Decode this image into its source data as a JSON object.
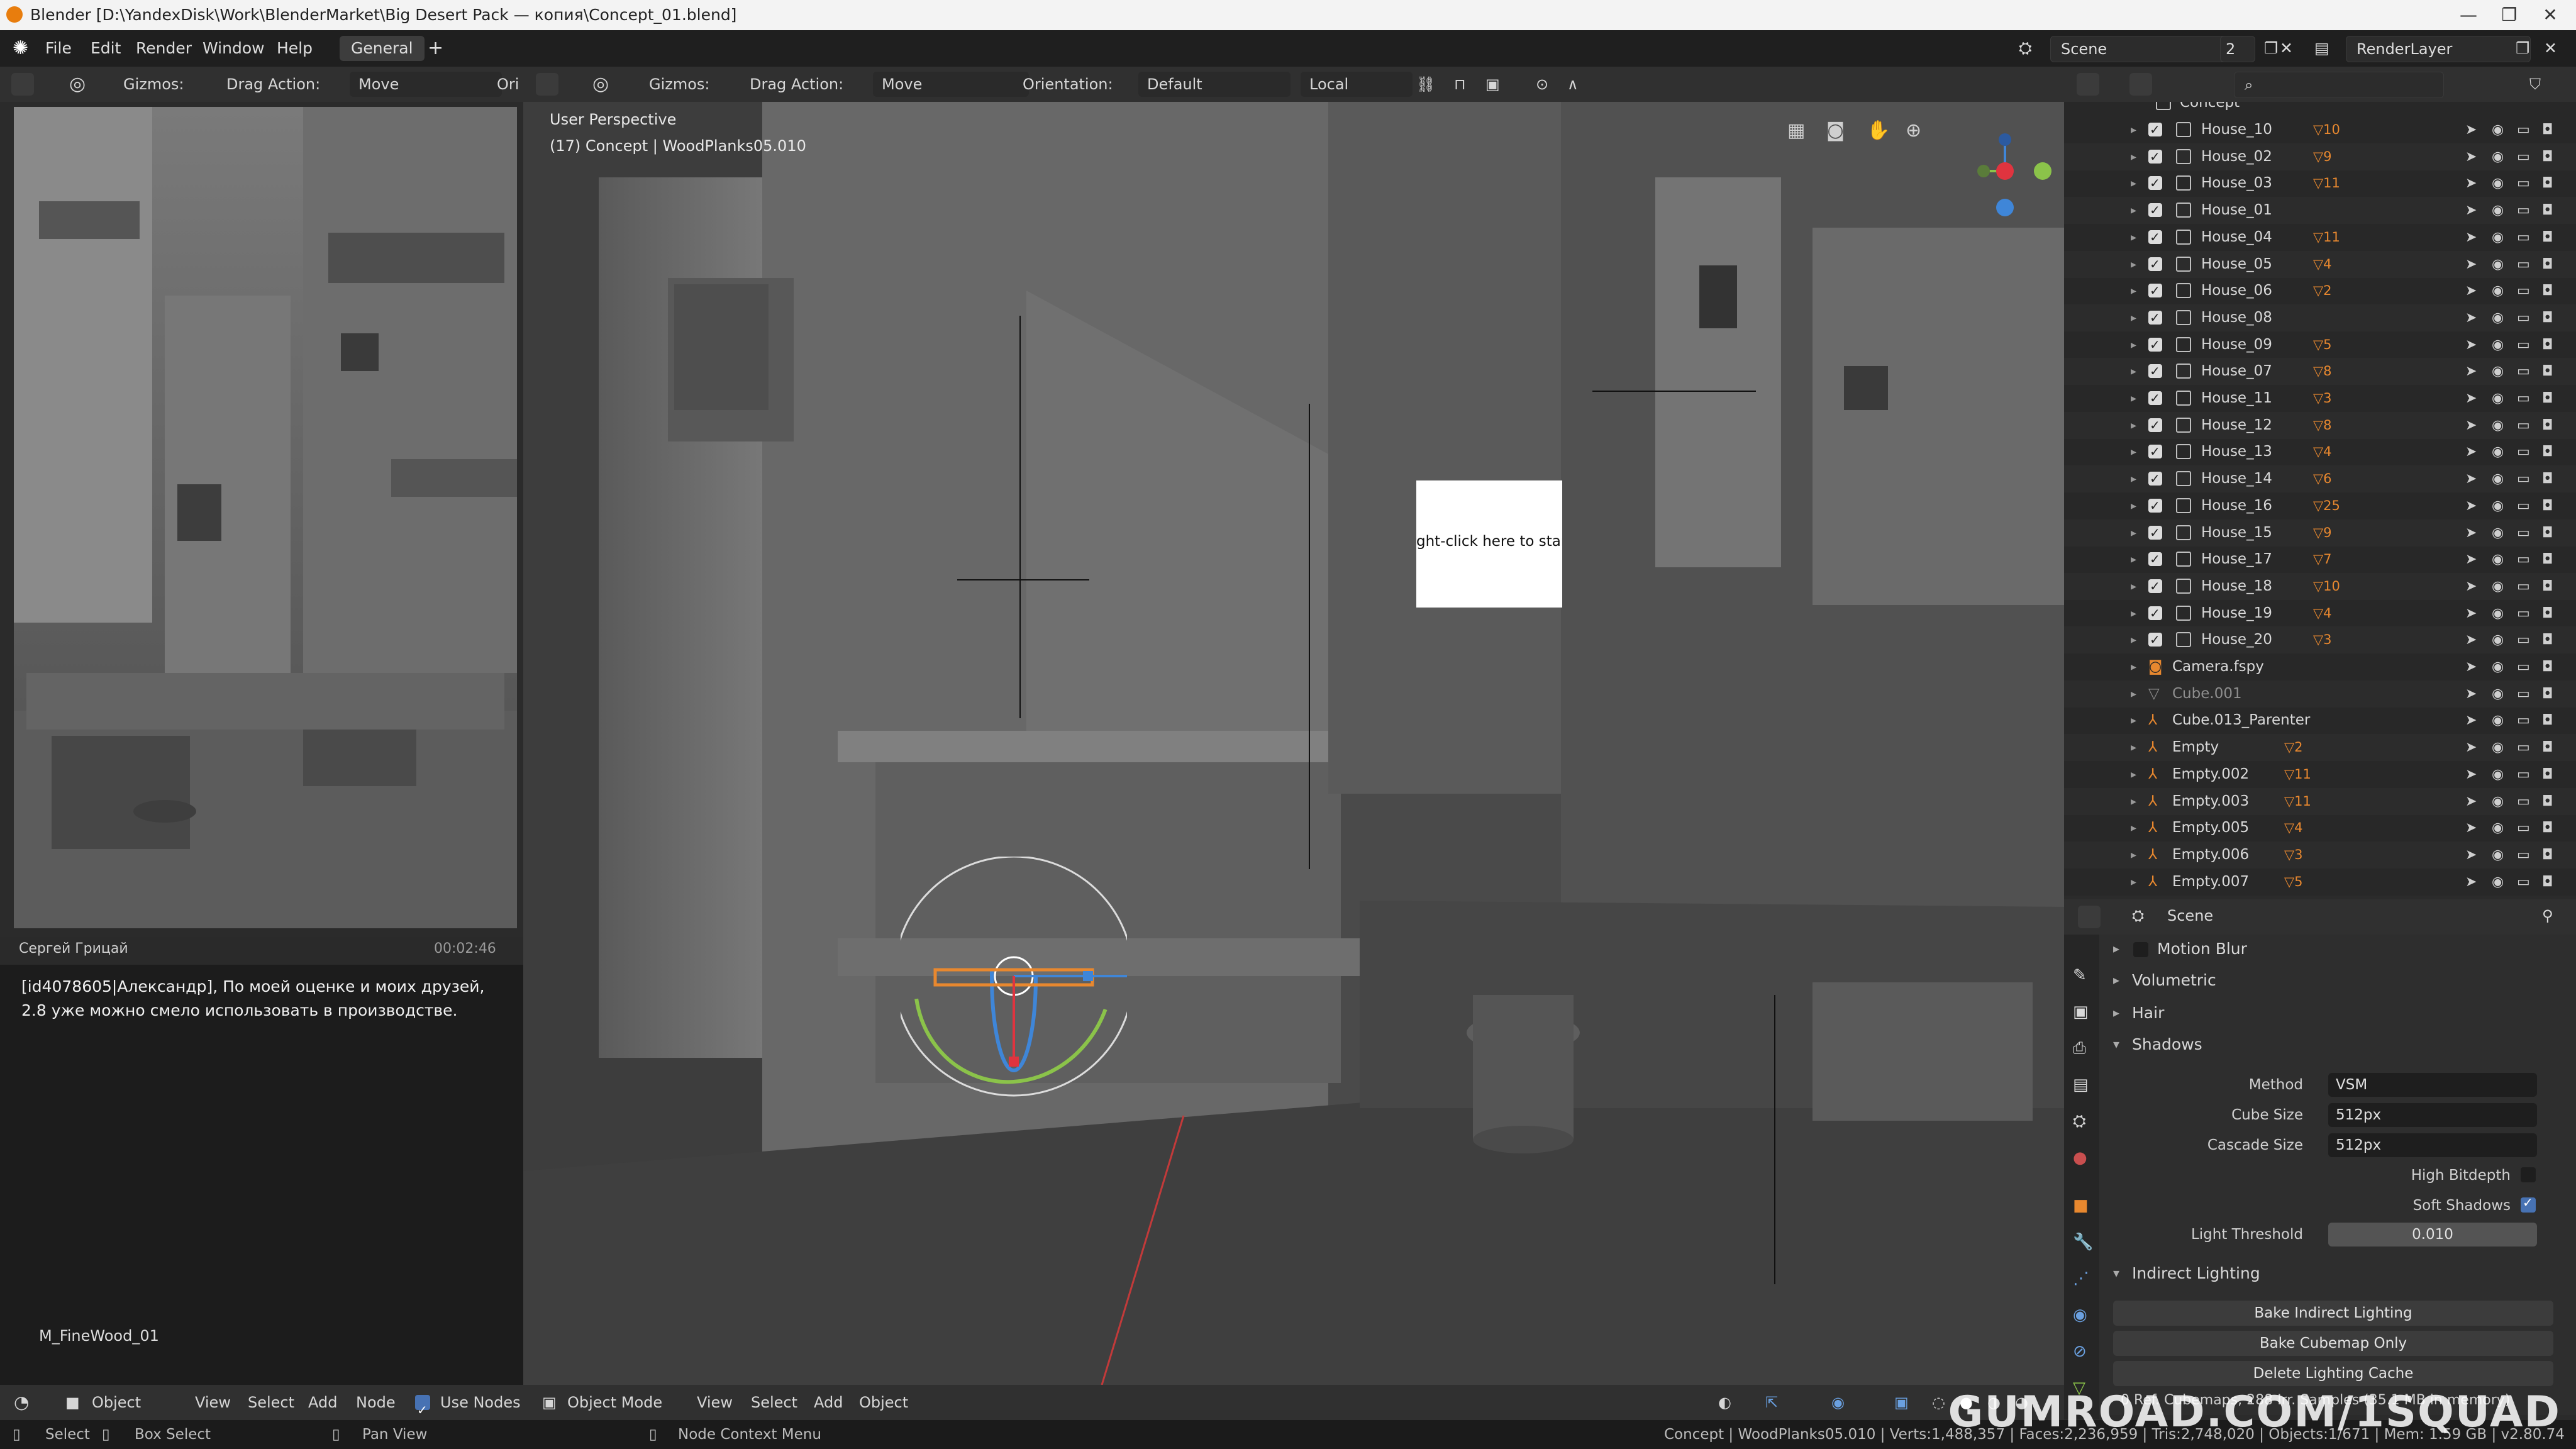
{
  "window": {
    "title": "Blender [D:\\YandexDisk\\Work\\BlenderMarket\\Big Desert Pack — копия\\Concept_01.blend]",
    "minimize": "—",
    "maximize": "❐",
    "close": "✕"
  },
  "menu": {
    "items": [
      "File",
      "Edit",
      "Render",
      "Window",
      "Help"
    ],
    "workspace_tab": "General",
    "add_tab": "+",
    "scene_label": "Scene",
    "scene_count": "2",
    "view_layer": "RenderLayer"
  },
  "left_editor_header": {
    "gizmos": "Gizmos:",
    "drag_action": "Drag Action:",
    "drag_value": "Move",
    "orient_cut": "Ori"
  },
  "viewport_header": {
    "gizmos": "Gizmos:",
    "drag_action": "Drag Action:",
    "drag_value": "Move",
    "orientation": "Orientation:",
    "orientation_value": "Default",
    "pivot": "Local"
  },
  "viewport": {
    "perspective": "User Perspective",
    "object_info": "(17) Concept | WoodPlanks05.010",
    "popup_text": "ght-click here to star"
  },
  "chat": {
    "username": "Сергей Грицай",
    "time": "00:02:46",
    "message": "[id4078605|Александр], По моей оценке и моих друзей, 2.8 уже можно смело использовать в производстве."
  },
  "node_editor": {
    "material": "M_FineWood_01",
    "header": [
      "Object",
      "View",
      "Select",
      "Add",
      "Node"
    ],
    "use_nodes": "Use Nodes"
  },
  "viewport_footer": {
    "mode": "Object Mode",
    "menus": [
      "View",
      "Select",
      "Add",
      "Object"
    ]
  },
  "outliner": {
    "top_label": "Concept",
    "rows": [
      {
        "name": "House_10",
        "badge": "10",
        "type": "collection"
      },
      {
        "name": "House_02",
        "badge": "9",
        "type": "collection"
      },
      {
        "name": "House_03",
        "badge": "11",
        "type": "collection"
      },
      {
        "name": "House_01",
        "badge": "",
        "type": "collection"
      },
      {
        "name": "House_04",
        "badge": "11",
        "type": "collection"
      },
      {
        "name": "House_05",
        "badge": "4",
        "type": "collection"
      },
      {
        "name": "House_06",
        "badge": "2",
        "type": "collection"
      },
      {
        "name": "House_08",
        "badge": "",
        "type": "collection"
      },
      {
        "name": "House_09",
        "badge": "5",
        "type": "collection"
      },
      {
        "name": "House_07",
        "badge": "8",
        "type": "collection"
      },
      {
        "name": "House_11",
        "badge": "3",
        "type": "collection"
      },
      {
        "name": "House_12",
        "badge": "8",
        "type": "collection"
      },
      {
        "name": "House_13",
        "badge": "4",
        "type": "collection"
      },
      {
        "name": "House_14",
        "badge": "6",
        "type": "collection"
      },
      {
        "name": "House_16",
        "badge": "25",
        "type": "collection"
      },
      {
        "name": "House_15",
        "badge": "9",
        "type": "collection"
      },
      {
        "name": "House_17",
        "badge": "7",
        "type": "collection"
      },
      {
        "name": "House_18",
        "badge": "10",
        "type": "collection"
      },
      {
        "name": "House_19",
        "badge": "4",
        "type": "collection"
      },
      {
        "name": "House_20",
        "badge": "3",
        "type": "collection"
      },
      {
        "name": "Camera.fspy",
        "badge": "",
        "type": "camera"
      },
      {
        "name": "Cube.001",
        "badge": "",
        "type": "mesh"
      },
      {
        "name": "Cube.013_Parenter",
        "badge": "",
        "type": "empty"
      },
      {
        "name": "Empty",
        "badge": "2",
        "type": "empty"
      },
      {
        "name": "Empty.002",
        "badge": "11",
        "type": "empty"
      },
      {
        "name": "Empty.003",
        "badge": "11",
        "type": "empty"
      },
      {
        "name": "Empty.005",
        "badge": "4",
        "type": "empty"
      },
      {
        "name": "Empty.006",
        "badge": "3",
        "type": "empty"
      },
      {
        "name": "Empty.007",
        "badge": "5",
        "type": "empty"
      }
    ]
  },
  "properties": {
    "context": "Scene",
    "sections": {
      "motion_blur": "Motion Blur",
      "volumetric": "Volumetric",
      "hair": "Hair",
      "shadows": "Shadows",
      "indirect": "Indirect Lighting"
    },
    "shadows": {
      "method_label": "Method",
      "method_value": "VSM",
      "cube_label": "Cube Size",
      "cube_value": "512px",
      "cascade_label": "Cascade Size",
      "cascade_value": "512px",
      "high_bitdepth": "High Bitdepth",
      "soft_shadows": "Soft Shadows",
      "light_threshold_label": "Light Threshold",
      "light_threshold_value": "0.010"
    },
    "buttons": {
      "bake_indirect": "Bake Indirect Lighting",
      "bake_cubemap": "Bake Cubemap Only",
      "delete_cache": "Delete Lighting Cache"
    },
    "cache_info": "0 Ref. Cubemaps, 288 Irr. Samples (35.1 MB in memory)"
  },
  "statusbar": {
    "select": "Select",
    "box_select": "Box Select",
    "pan_view": "Pan View",
    "context_menu": "Node Context Menu",
    "stats": "Concept | WoodPlanks05.010 | Verts:1,488,357 | Faces:2,236,959 | Tris:2,748,020 | Objects:1/671 | Mem: 1.59 GB | v2.80.74"
  },
  "watermark": "GUMROAD.COM/1SQUAD",
  "colors": {
    "accent_orange": "#e8882f",
    "blue_active": "#4772b3",
    "gizmo_red": "#e0343f",
    "gizmo_green": "#8bc34a",
    "gizmo_blue": "#3f86d8"
  }
}
